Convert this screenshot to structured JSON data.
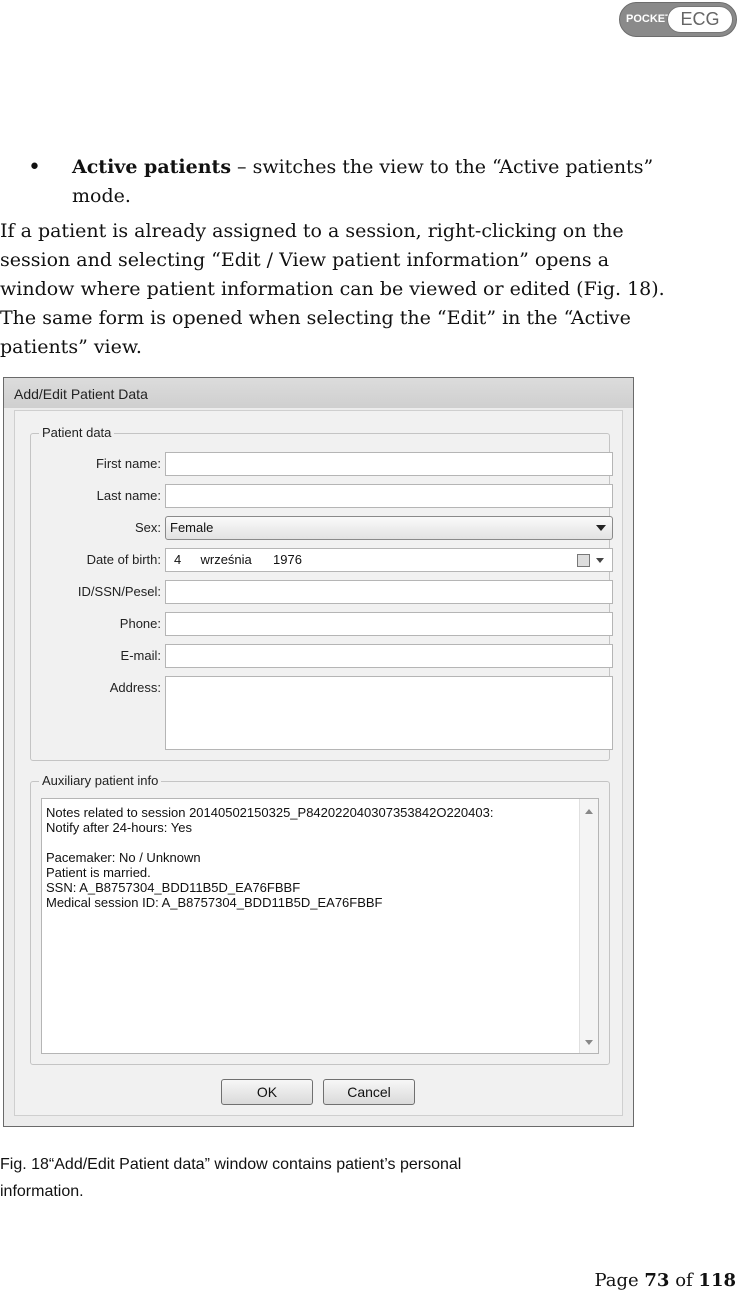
{
  "logo": {
    "left_text": "POCKET",
    "right_text": "ECG"
  },
  "bullet": {
    "bold": "Active patients",
    "rest": " – switches the view to the “Active patients” mode."
  },
  "paragraph": [
    "If a patient is already assigned to a session, right-clicking on the",
    "session and selecting “Edit / View patient information” opens a",
    "window where patient information can be viewed or edited (Fig. 18).",
    "The same form is opened when selecting the “Edit” in the “Active",
    "patients” view."
  ],
  "dialog": {
    "title": "Add/Edit Patient Data",
    "patient_group_label": "Patient data",
    "fields": {
      "first_name_label": "First name:",
      "first_name_value": "",
      "last_name_label": "Last name:",
      "last_name_value": "",
      "sex_label": "Sex:",
      "sex_value": "Female",
      "dob_label": "Date of birth:",
      "dob_day": "4",
      "dob_month": "września",
      "dob_year": "1976",
      "id_label": "ID/SSN/Pesel:",
      "id_value": "",
      "phone_label": "Phone:",
      "phone_value": "",
      "email_label": "E-mail:",
      "email_value": "",
      "address_label": "Address:",
      "address_value": ""
    },
    "aux_group_label": "Auxiliary patient info",
    "aux_lines": [
      "Notes related to session 20140502150325_P842022040307353842O220403:",
      "Notify after 24-hours: Yes",
      "",
      "Pacemaker: No / Unknown",
      "Patient is married.",
      "SSN: A_B8757304_BDD11B5D_EA76FBBF",
      "Medical session ID: A_B8757304_BDD11B5D_EA76FBBF"
    ],
    "ok_label": "OK",
    "cancel_label": "Cancel"
  },
  "caption": [
    "Fig. 18“Add/Edit Patient data” window contains patient’s personal",
    "information."
  ],
  "page": {
    "prefix": "Page ",
    "current": "73",
    "middle": " of ",
    "total": "118"
  }
}
